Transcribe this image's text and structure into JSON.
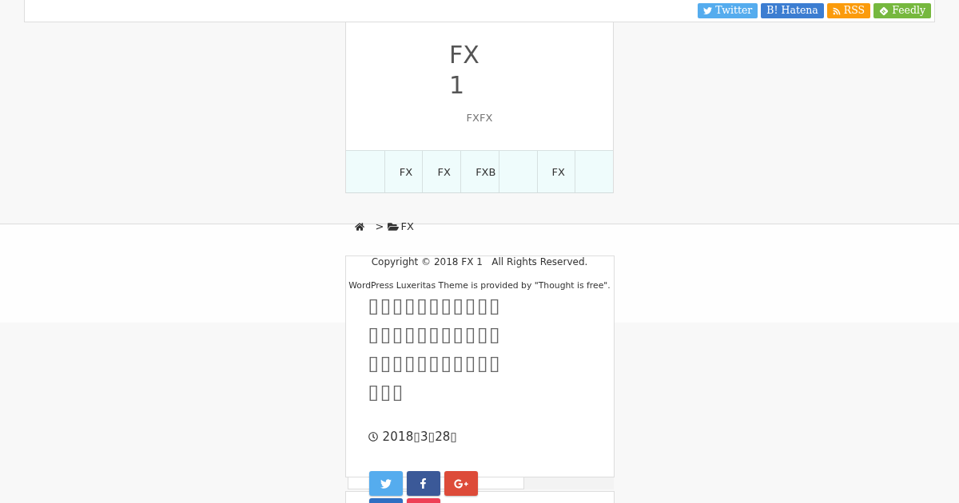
{
  "top_bar": {
    "follow_buttons": [
      {
        "kind": "twitter",
        "label": "Twitter"
      },
      {
        "kind": "hatena",
        "label": "B! Hatena"
      },
      {
        "kind": "rss",
        "label": "RSS"
      },
      {
        "kind": "feedly",
        "label": "Feedly"
      }
    ]
  },
  "header": {
    "site_title": "FX 1",
    "tagline": "FXFX"
  },
  "nav": {
    "items": [
      {
        "kind": "empty"
      },
      {
        "kind": "link",
        "label": "FX"
      },
      {
        "kind": "link",
        "label": "FX"
      },
      {
        "kind": "link",
        "label": "FXB"
      },
      {
        "kind": "empty"
      },
      {
        "kind": "link",
        "label": "FX"
      },
      {
        "kind": "empty"
      }
    ]
  },
  "breadcrumb": {
    "items": [
      {
        "kind": "home"
      },
      {
        "kind": "separator",
        "label": ">"
      },
      {
        "kind": "category",
        "label": "FX"
      }
    ]
  },
  "footer": {
    "copyright": "Copyright © 2018 FX 1   All Rights Reserved.",
    "credit": "WordPress Luxeritas Theme is provided by \"Thought is free\"."
  },
  "post": {
    "title": "▯▯▯▯▯▯▯▯▯▯▯▯▯▯▯▯▯▯▯▯▯▯▯▯▯▯▯▯▯▯▯▯▯▯▯▯",
    "date": "2018▯3▯28▯"
  },
  "share_buttons": [
    {
      "kind": "twitter"
    },
    {
      "kind": "facebook"
    },
    {
      "kind": "google-plus"
    },
    {
      "kind": "hatena"
    },
    {
      "kind": "pocket"
    }
  ]
}
